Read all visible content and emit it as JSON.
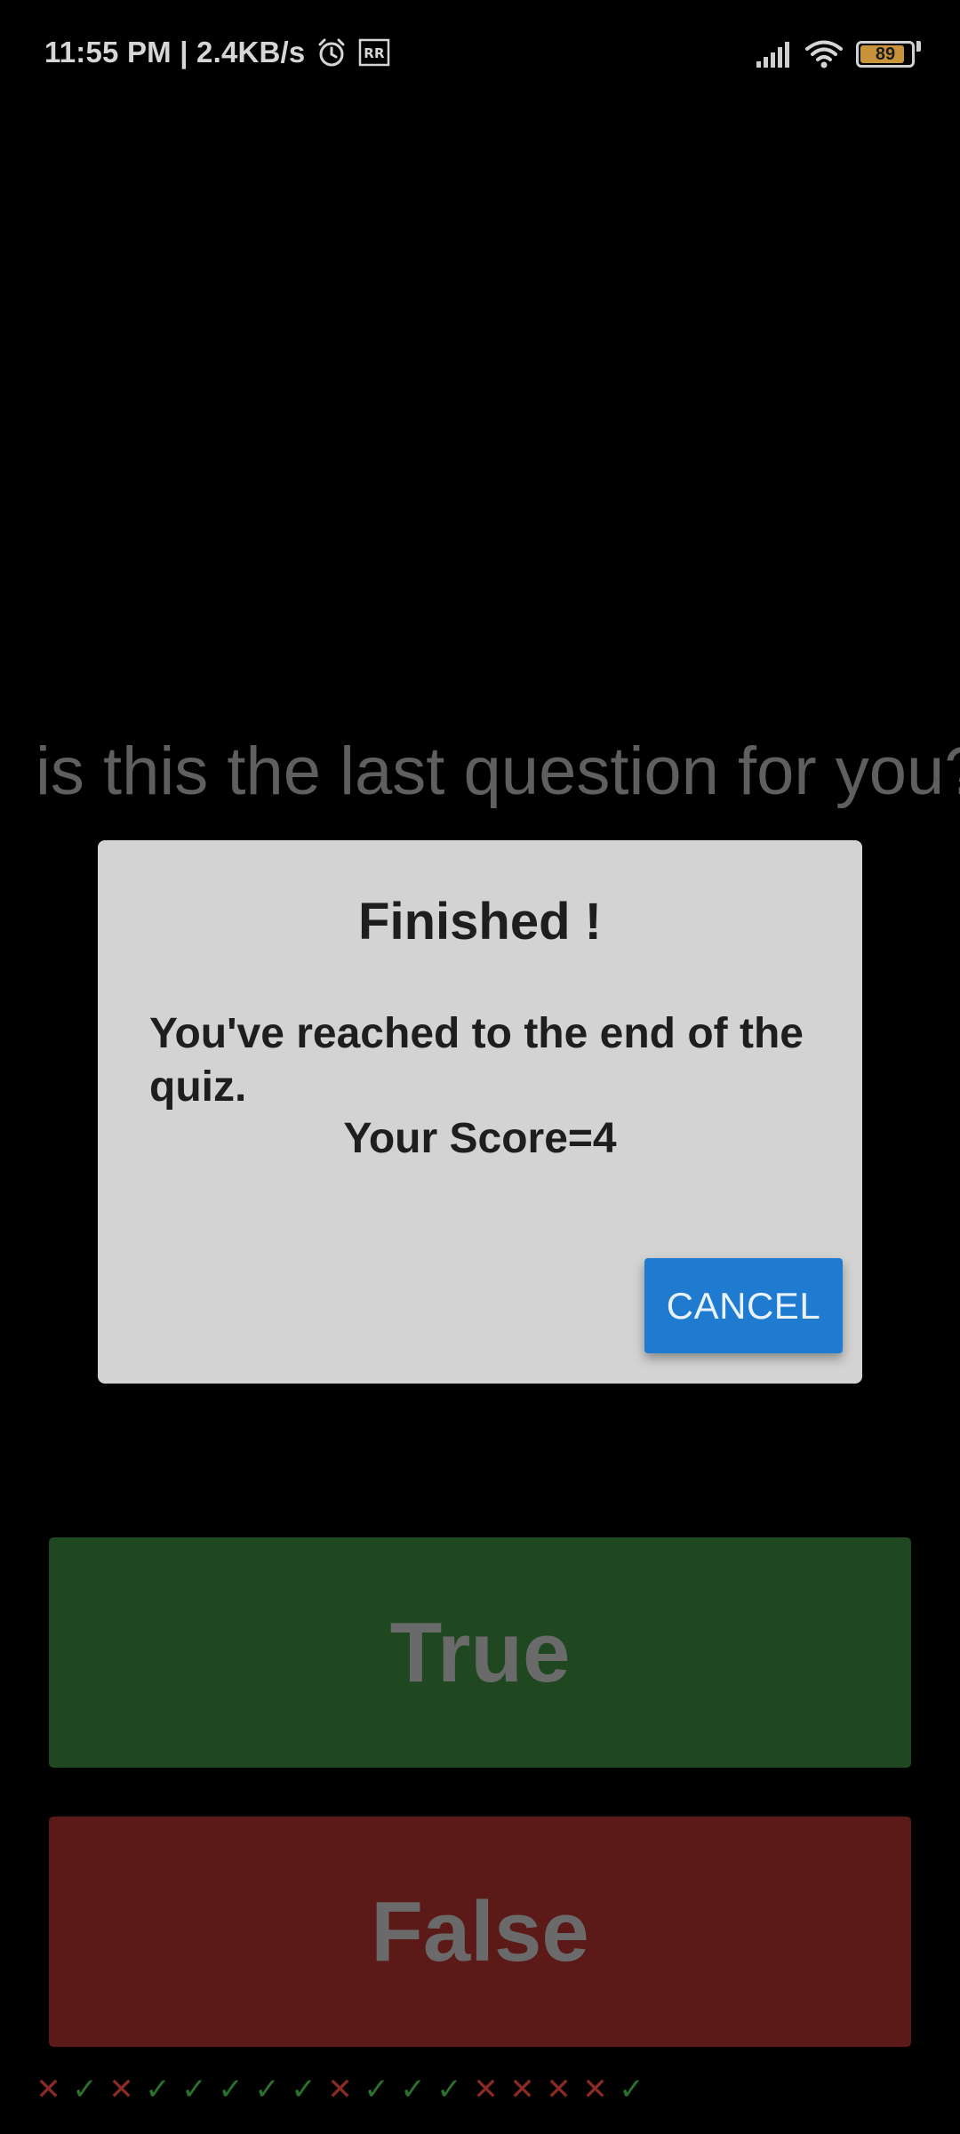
{
  "status_bar": {
    "time_speed": "11:55 PM | 2.4KB/s",
    "alarm_icon": "alarm-clock-icon",
    "rr_icon": "rr-badge-icon",
    "signal_icon": "signal-bars-icon",
    "wifi_icon": "wifi-icon",
    "battery_level": "89",
    "battery_fraction": 0.89
  },
  "question": {
    "text": "is this the last question for you?"
  },
  "answers": {
    "true_label": "True",
    "false_label": "False"
  },
  "dialog": {
    "title": "Finished !",
    "message": "You've reached to the end of the quiz.",
    "score_text": "Your Score=4",
    "cancel_label": "CANCEL"
  },
  "score_track": {
    "marks": [
      "✕",
      "✓",
      "✕",
      "✓",
      "✓",
      "✓",
      "✓",
      "✓",
      "✕",
      "✓",
      "✓",
      "✓",
      "✕",
      "✕",
      "✕",
      "✕",
      "✓"
    ]
  },
  "colors": {
    "correct": "#2a6f2c",
    "wrong": "#8a2a24",
    "true_button": "#1f4720",
    "false_button": "#5b1a17",
    "dialog_bg": "#d3d3d3",
    "accent": "#1e7bd0"
  }
}
